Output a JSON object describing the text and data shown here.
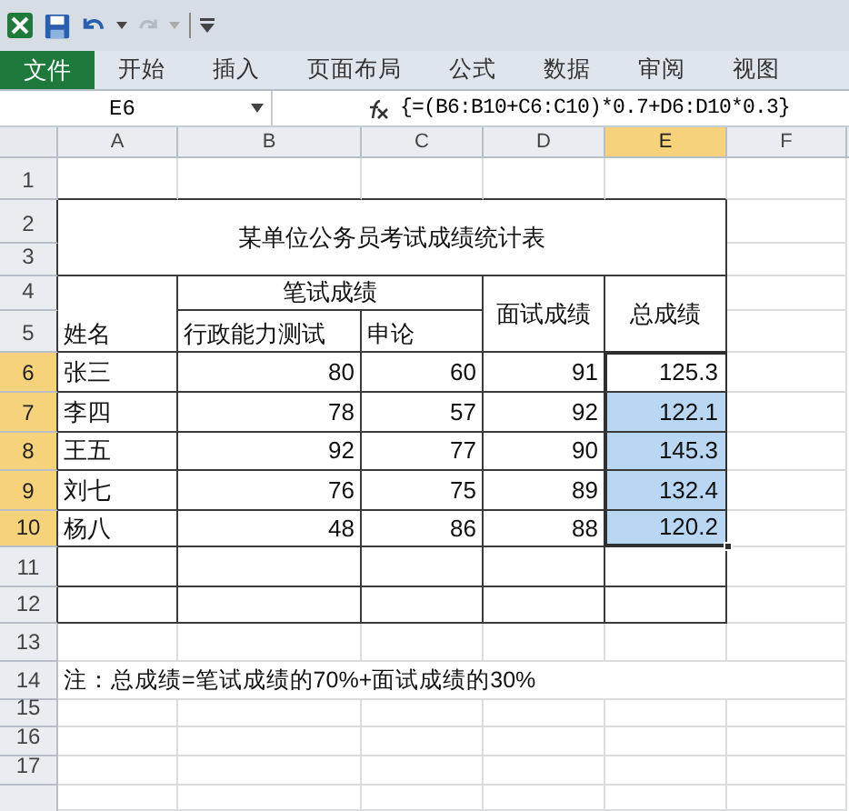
{
  "quick_access": {
    "redo_disabled": true
  },
  "ribbon_tabs": [
    {
      "label": "文件",
      "kind": "file",
      "selected": false
    },
    {
      "label": "开始",
      "kind": "tab",
      "selected": false
    },
    {
      "label": "插入",
      "kind": "tab",
      "selected": false
    },
    {
      "label": "页面布局",
      "kind": "tab",
      "selected": false
    },
    {
      "label": "公式",
      "kind": "tab",
      "selected": false
    },
    {
      "label": "数据",
      "kind": "tab",
      "selected": false
    },
    {
      "label": "审阅",
      "kind": "tab",
      "selected": false
    },
    {
      "label": "视图",
      "kind": "tab",
      "selected": false
    }
  ],
  "name_box": "E6",
  "formula": "{=(B6:B10+C6:C10)*0.7+D6:D10*0.3}",
  "columns": [
    {
      "label": "A",
      "selected": false
    },
    {
      "label": "B",
      "selected": false
    },
    {
      "label": "C",
      "selected": false
    },
    {
      "label": "D",
      "selected": false
    },
    {
      "label": "E",
      "selected": true
    },
    {
      "label": "F",
      "selected": false
    }
  ],
  "rows": [
    {
      "label": "1",
      "selected": false
    },
    {
      "label": "2",
      "selected": false
    },
    {
      "label": "3",
      "selected": false
    },
    {
      "label": "4",
      "selected": false
    },
    {
      "label": "5",
      "selected": false
    },
    {
      "label": "6",
      "selected": true
    },
    {
      "label": "7",
      "selected": true
    },
    {
      "label": "8",
      "selected": true
    },
    {
      "label": "9",
      "selected": true
    },
    {
      "label": "10",
      "selected": true
    },
    {
      "label": "11",
      "selected": false
    },
    {
      "label": "12",
      "selected": false
    },
    {
      "label": "13",
      "selected": false
    },
    {
      "label": "14",
      "selected": false
    },
    {
      "label": "15",
      "selected": false
    },
    {
      "label": "16",
      "selected": false
    },
    {
      "label": "17",
      "selected": false
    }
  ],
  "table": {
    "title": "某单位公务员考试成绩统计表",
    "group_header": "笔试成绩",
    "headers": {
      "name": "姓名",
      "aptitude": "行政能力测试",
      "essay": "申论",
      "interview": "面试成绩",
      "total": "总成绩"
    },
    "records": [
      {
        "name": "张三",
        "aptitude": "80",
        "essay": "60",
        "interview": "91",
        "total": "125.3",
        "selected": true,
        "active": true
      },
      {
        "name": "李四",
        "aptitude": "78",
        "essay": "57",
        "interview": "92",
        "total": "122.1",
        "selected": true,
        "active": false
      },
      {
        "name": "王五",
        "aptitude": "92",
        "essay": "77",
        "interview": "90",
        "total": "145.3",
        "selected": true,
        "active": false
      },
      {
        "name": "刘七",
        "aptitude": "76",
        "essay": "75",
        "interview": "89",
        "total": "132.4",
        "selected": true,
        "active": false
      },
      {
        "name": "杨八",
        "aptitude": "48",
        "essay": "86",
        "interview": "88",
        "total": "120.2",
        "selected": true,
        "active": false
      }
    ]
  },
  "note": "注：总成绩=笔试成绩的70%+面试成绩的30%"
}
